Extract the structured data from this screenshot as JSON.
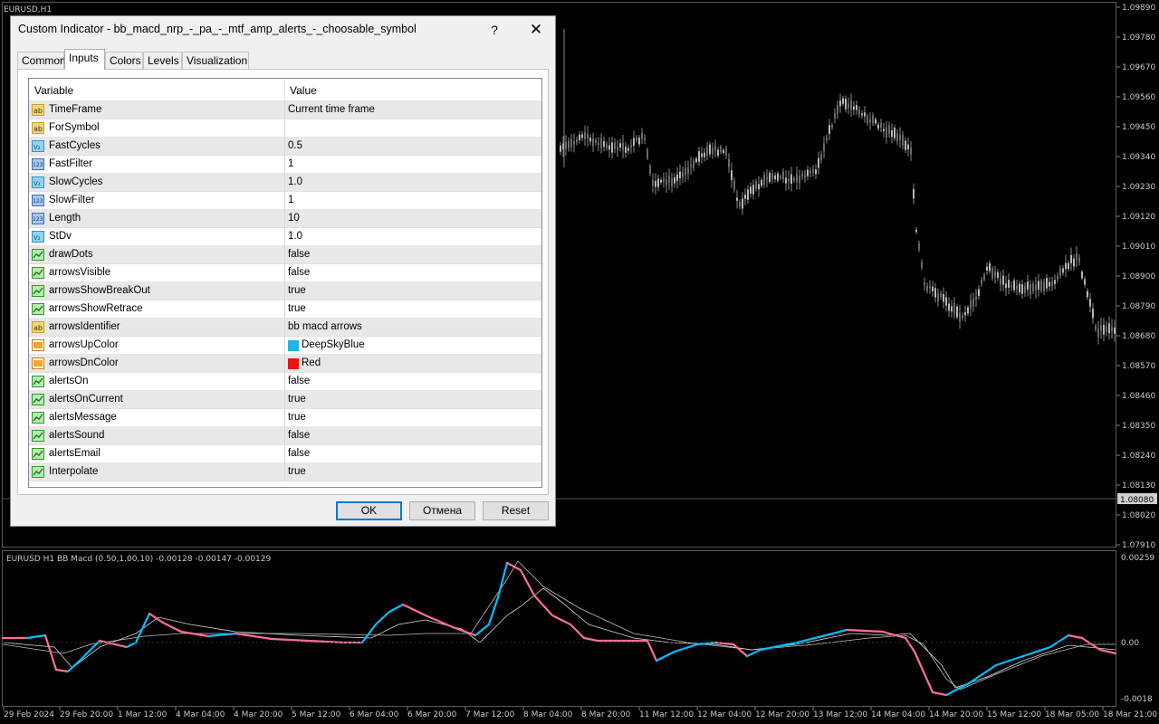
{
  "chart": {
    "symbol_label": "EURUSD,H1",
    "price_levels": [
      "1.09890",
      "1.09780",
      "1.09670",
      "1.09560",
      "1.09450",
      "1.09340",
      "1.09230",
      "1.09120",
      "1.09010",
      "1.08900",
      "1.08790",
      "1.08680",
      "1.08570",
      "1.08460",
      "1.08350",
      "1.08240",
      "1.08130",
      "1.08020",
      "1.07910"
    ],
    "current_price": "1.08080",
    "indicator_title": "EURUSD H1 BB Macd (0.50,1.00,10) -0.00128 -0.00147 -0.00129",
    "indicator_levels": [
      "0.00259",
      "0.00",
      "-0.0018"
    ],
    "time_labels": [
      "29 Feb 2024",
      "29 Feb 20:00",
      "1 Mar 12:00",
      "4 Mar 04:00",
      "4 Mar 20:00",
      "5 Mar 12:00",
      "6 Mar 04:00",
      "6 Mar 20:00",
      "7 Mar 12:00",
      "8 Mar 04:00",
      "8 Mar 20:00",
      "11 Mar 12:00",
      "12 Mar 04:00",
      "12 Mar 20:00",
      "13 Mar 12:00",
      "14 Mar 04:00",
      "14 Mar 20:00",
      "15 Mar 12:00",
      "18 Mar 05:00",
      "18 Mar 21:00"
    ],
    "colors": {
      "up": "#00BFFF",
      "dn": "#FF6F91",
      "candle": "#9a9a9a",
      "signal": "#cfcfcf"
    }
  },
  "dialog": {
    "title": "Custom Indicator - bb_macd_nrp_-_pa_-_mtf_amp_alerts_-_choosable_symbol",
    "help": "?",
    "close": "✕",
    "tabs": [
      "Common",
      "Inputs",
      "Colors",
      "Levels",
      "Visualization"
    ],
    "active_tab": "Inputs",
    "header": {
      "variable": "Variable",
      "value": "Value"
    },
    "rows": [
      {
        "icon": "ab-icon",
        "name": "TimeFrame",
        "value": "Current time frame"
      },
      {
        "icon": "ab-icon",
        "name": "ForSymbol",
        "value": ""
      },
      {
        "icon": "double-icon",
        "name": "FastCycles",
        "value": "0.5"
      },
      {
        "icon": "int-icon",
        "name": "FastFilter",
        "value": "1"
      },
      {
        "icon": "double-icon",
        "name": "SlowCycles",
        "value": "1.0"
      },
      {
        "icon": "int-icon",
        "name": "SlowFilter",
        "value": "1"
      },
      {
        "icon": "int-icon",
        "name": "Length",
        "value": "10"
      },
      {
        "icon": "double-icon",
        "name": "StDv",
        "value": "1.0"
      },
      {
        "icon": "bool-icon",
        "name": "drawDots",
        "value": "false"
      },
      {
        "icon": "bool-icon",
        "name": "arrowsVisible",
        "value": "false"
      },
      {
        "icon": "bool-icon",
        "name": "arrowsShowBreakOut",
        "value": "true"
      },
      {
        "icon": "bool-icon",
        "name": "arrowsShowRetrace",
        "value": "true"
      },
      {
        "icon": "ab-icon",
        "name": "arrowsIdentifier",
        "value": "bb macd arrows"
      },
      {
        "icon": "color-icon",
        "name": "arrowsUpColor",
        "value": "DeepSkyBlue",
        "swatch": "#1EB4E8"
      },
      {
        "icon": "color-icon",
        "name": "arrowsDnColor",
        "value": "Red",
        "swatch": "#EE1111"
      },
      {
        "icon": "bool-icon",
        "name": "alertsOn",
        "value": "false"
      },
      {
        "icon": "bool-icon",
        "name": "alertsOnCurrent",
        "value": "true"
      },
      {
        "icon": "bool-icon",
        "name": "alertsMessage",
        "value": "true"
      },
      {
        "icon": "bool-icon",
        "name": "alertsSound",
        "value": "false"
      },
      {
        "icon": "bool-icon",
        "name": "alertsEmail",
        "value": "false"
      },
      {
        "icon": "bool-icon",
        "name": "Interpolate",
        "value": "true"
      }
    ],
    "buttons": {
      "ok": "OK",
      "cancel": "Отмена",
      "reset": "Reset"
    }
  }
}
